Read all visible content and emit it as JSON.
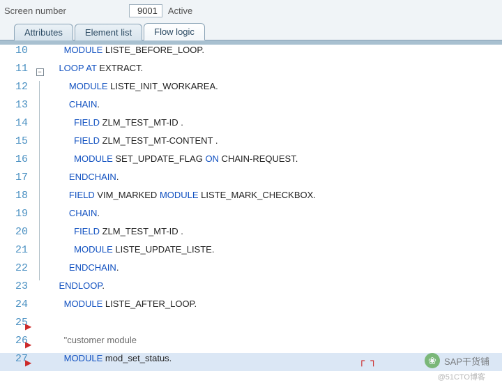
{
  "header": {
    "label": "Screen number",
    "screen_number": "9001",
    "status": "Active"
  },
  "tabs": [
    {
      "label": "Attributes",
      "active": false
    },
    {
      "label": "Element list",
      "active": false
    },
    {
      "label": "Flow logic",
      "active": true
    }
  ],
  "code_lines": [
    {
      "n": 10,
      "indent": 3,
      "tokens": [
        [
          "kw",
          "MODULE"
        ],
        [
          "id",
          " LISTE_BEFORE_LOOP."
        ]
      ]
    },
    {
      "n": 11,
      "indent": 2,
      "fold": "minus",
      "tokens": [
        [
          "kw",
          "LOOP AT"
        ],
        [
          "id",
          " EXTRACT."
        ]
      ]
    },
    {
      "n": 12,
      "indent": 4,
      "guide": true,
      "tokens": [
        [
          "kw",
          "MODULE"
        ],
        [
          "id",
          " LISTE_INIT_WORKAREA."
        ]
      ]
    },
    {
      "n": 13,
      "indent": 4,
      "guide": true,
      "tokens": [
        [
          "kw",
          "CHAIN"
        ],
        [
          "id",
          "."
        ]
      ]
    },
    {
      "n": 14,
      "indent": 5,
      "guide": true,
      "tokens": [
        [
          "kw",
          "FIELD"
        ],
        [
          "id",
          " ZLM_TEST_MT-ID ."
        ]
      ]
    },
    {
      "n": 15,
      "indent": 5,
      "guide": true,
      "tokens": [
        [
          "kw",
          "FIELD"
        ],
        [
          "id",
          " ZLM_TEST_MT-CONTENT ."
        ]
      ]
    },
    {
      "n": 16,
      "indent": 5,
      "guide": true,
      "tokens": [
        [
          "kw",
          "MODULE"
        ],
        [
          "id",
          " SET_UPDATE_FLAG "
        ],
        [
          "kw",
          "ON"
        ],
        [
          "id",
          " CHAIN-REQUEST."
        ]
      ]
    },
    {
      "n": 17,
      "indent": 4,
      "guide": true,
      "tokens": [
        [
          "kw",
          "ENDCHAIN"
        ],
        [
          "id",
          "."
        ]
      ]
    },
    {
      "n": 18,
      "indent": 4,
      "guide": true,
      "tokens": [
        [
          "kw",
          "FIELD"
        ],
        [
          "id",
          " VIM_MARKED "
        ],
        [
          "kw",
          "MODULE"
        ],
        [
          "id",
          " LISTE_MARK_CHECKBOX."
        ]
      ]
    },
    {
      "n": 19,
      "indent": 4,
      "guide": true,
      "tokens": [
        [
          "kw",
          "CHAIN"
        ],
        [
          "id",
          "."
        ]
      ]
    },
    {
      "n": 20,
      "indent": 5,
      "guide": true,
      "tokens": [
        [
          "kw",
          "FIELD"
        ],
        [
          "id",
          " ZLM_TEST_MT-ID ."
        ]
      ]
    },
    {
      "n": 21,
      "indent": 5,
      "guide": true,
      "tokens": [
        [
          "kw",
          "MODULE"
        ],
        [
          "id",
          " LISTE_UPDATE_LISTE."
        ]
      ]
    },
    {
      "n": 22,
      "indent": 4,
      "guide": true,
      "tokens": [
        [
          "kw",
          "ENDCHAIN"
        ],
        [
          "id",
          "."
        ]
      ]
    },
    {
      "n": 23,
      "indent": 2,
      "tokens": [
        [
          "kw",
          "ENDLOOP"
        ],
        [
          "id",
          "."
        ]
      ]
    },
    {
      "n": 24,
      "indent": 3,
      "tokens": [
        [
          "kw",
          "MODULE"
        ],
        [
          "id",
          " LISTE_AFTER_LOOP."
        ]
      ]
    },
    {
      "n": 25,
      "indent": 0,
      "mark": true,
      "tokens": []
    },
    {
      "n": 26,
      "indent": 3,
      "mark": true,
      "tokens": [
        [
          "cmt",
          "\"customer module"
        ]
      ]
    },
    {
      "n": 27,
      "indent": 3,
      "mark": true,
      "highlight": true,
      "tokens": [
        [
          "kw",
          "MODULE"
        ],
        [
          "id",
          " mod_set_status."
        ]
      ],
      "bracket": true
    }
  ],
  "watermark": {
    "main": "SAP干货铺",
    "sub": "@51CTO博客"
  },
  "icons": {
    "wechat": "❀"
  }
}
